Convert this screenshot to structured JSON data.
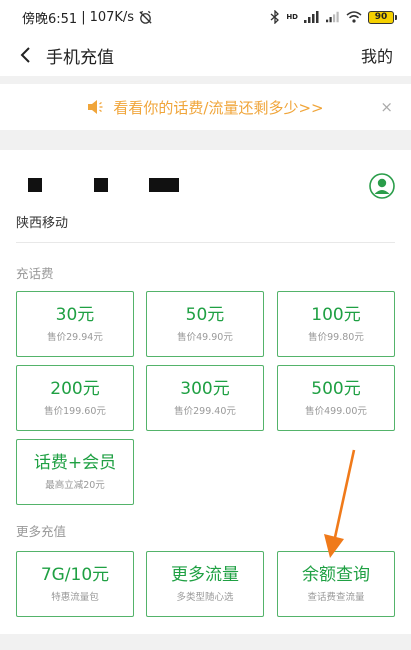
{
  "status": {
    "time": "傍晚6:51",
    "speed": "107K/s",
    "network": "HD",
    "battery": "90"
  },
  "header": {
    "title": "手机充值",
    "mine": "我的"
  },
  "notice": {
    "text": "看看你的话费/流量还剩多少>>",
    "close": "×"
  },
  "account": {
    "carrier": "陕西移动"
  },
  "recharge": {
    "label": "充话费",
    "options": [
      {
        "value": "30元",
        "price": "售价29.94元"
      },
      {
        "value": "50元",
        "price": "售价49.90元"
      },
      {
        "value": "100元",
        "price": "售价99.80元"
      },
      {
        "value": "200元",
        "price": "售价199.60元"
      },
      {
        "value": "300元",
        "price": "售价299.40元"
      },
      {
        "value": "500元",
        "price": "售价499.00元"
      },
      {
        "value": "话费+会员",
        "price": "最高立减20元"
      }
    ]
  },
  "more": {
    "label": "更多充值",
    "options": [
      {
        "value": "7G/10元",
        "desc": "特惠流量包"
      },
      {
        "value": "更多流量",
        "desc": "多类型随心选"
      },
      {
        "value": "余额查询",
        "desc": "查话费查流量"
      }
    ]
  },
  "colors": {
    "accent_green": "#1fa043",
    "border_green": "#53b36a",
    "notice_orange": "#f0a53a",
    "arrow_orange": "#f07a1a"
  },
  "icons": [
    "back-arrow-icon",
    "megaphone-icon",
    "close-icon",
    "avatar-icon",
    "bluetooth-icon",
    "alarm-off-icon",
    "signal-icon",
    "wifi-icon",
    "battery-icon"
  ]
}
